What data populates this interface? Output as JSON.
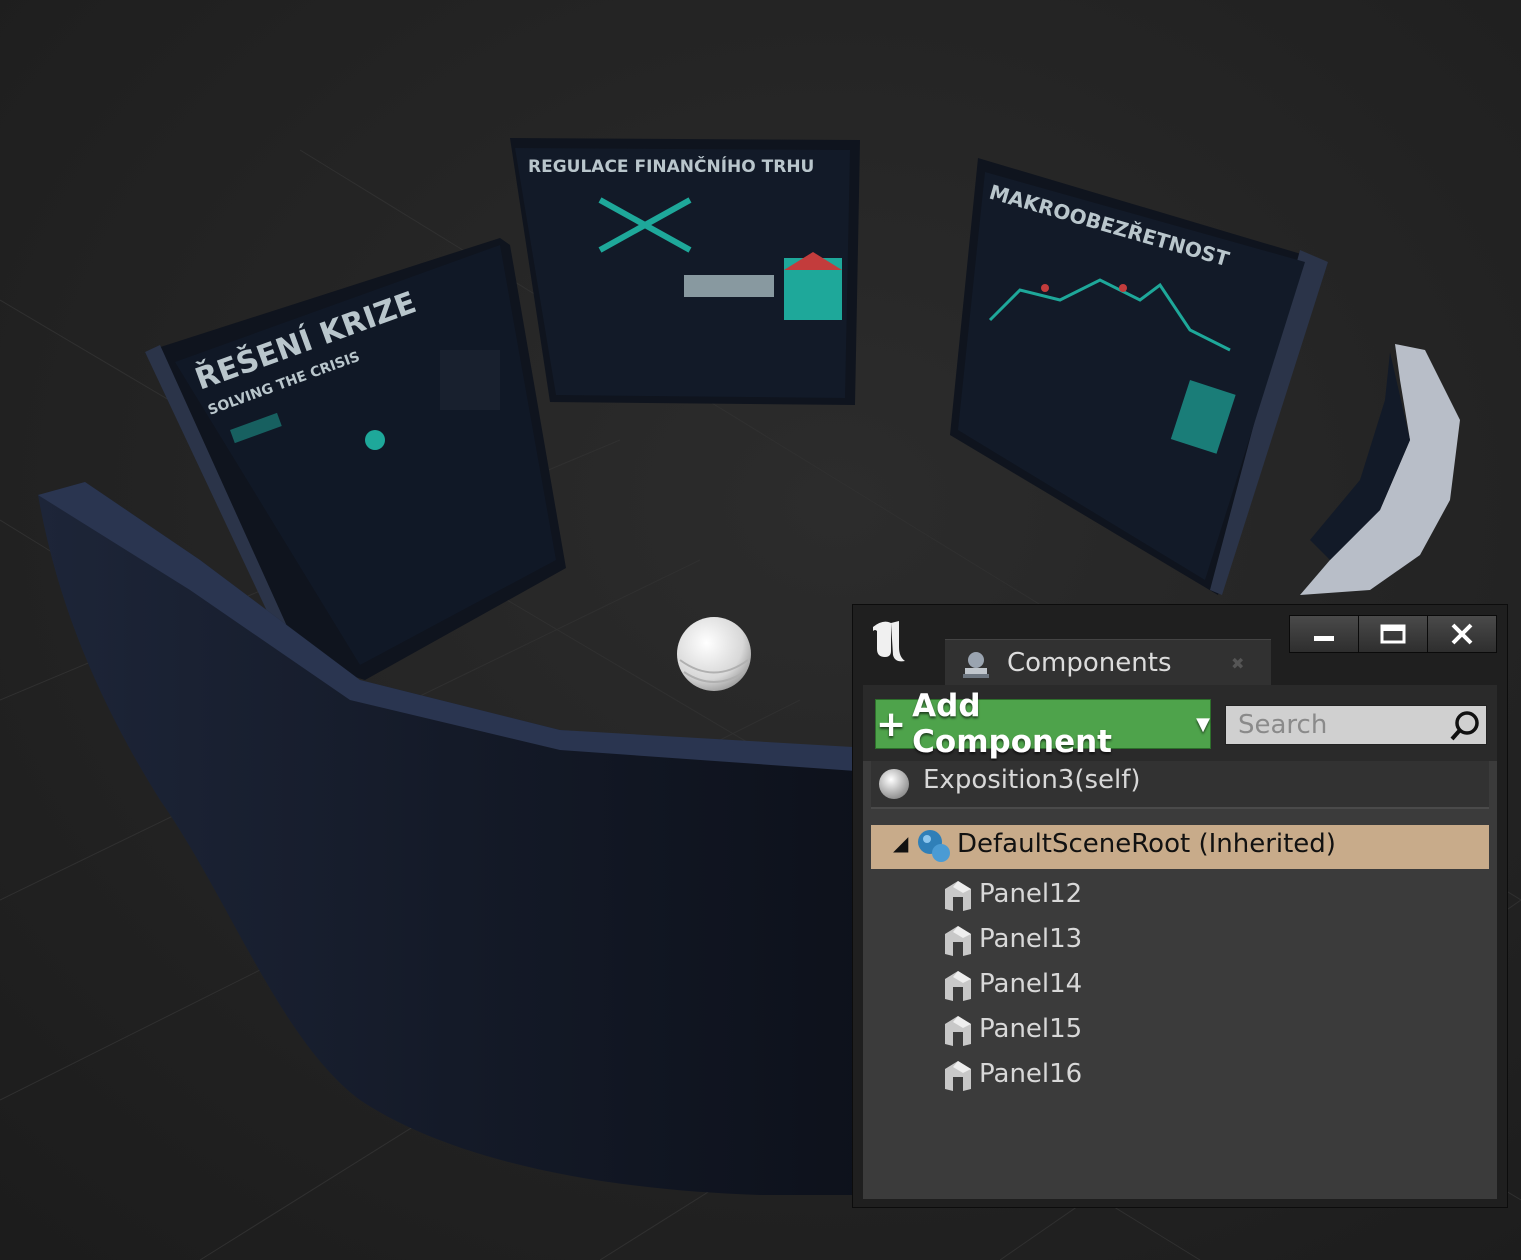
{
  "scene": {
    "posters": [
      {
        "title": "ŘEŠENÍ KRIZE",
        "subtitle": "SOLVING THE CRISIS"
      },
      {
        "title": "REGULACE FINANČNÍHO TRHU"
      },
      {
        "title": "MAKROOBEZŘETNOST"
      }
    ]
  },
  "panel": {
    "tab_label": "Components",
    "add_component_label": "Add Component",
    "search_placeholder": "Search",
    "self_item": "Exposition3(self)",
    "root_item": "DefaultSceneRoot (Inherited)",
    "children": [
      "Panel12",
      "Panel13",
      "Panel14",
      "Panel15",
      "Panel16"
    ],
    "icons": {
      "logo": "unreal-logo-icon",
      "tab": "components-icon",
      "search": "search-icon",
      "self": "sphere-icon",
      "root": "scene-root-icon",
      "child": "static-mesh-icon"
    },
    "colors": {
      "add_button": "#4ea34b",
      "selected_row": "#c8ab8a"
    }
  }
}
